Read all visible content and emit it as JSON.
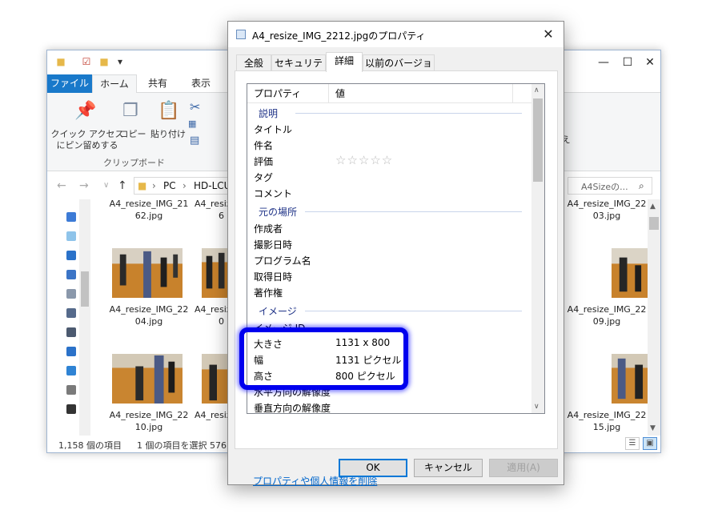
{
  "explorer": {
    "ribbon_tabs": [
      "ファイル",
      "ホーム",
      "共有",
      "表示"
    ],
    "ribbon": {
      "pin_label_line1": "クイック アクセス",
      "pin_label_line2": "にピン留めする",
      "copy_label": "コピー",
      "paste_label": "貼り付け",
      "group_label": "クリップボード",
      "cut_right_label": "え"
    },
    "address": {
      "segment1": "PC",
      "segment2": "HD-LCU",
      "search_placeholder": "A4Sizeの..."
    },
    "files": [
      {
        "line1": "A4_resize_IMG_21",
        "line2": "62.jpg"
      },
      {
        "line1": "A4_resize_IMG_22",
        "line2": "04.jpg"
      },
      {
        "line1": "A4_resize_IMG_22",
        "line2": "10.jpg"
      },
      {
        "line1": "A4_resiz",
        "line2": "6"
      },
      {
        "line1": "A4_resiz",
        "line2": "0"
      },
      {
        "line1": "A4_resiz",
        "line2": ""
      },
      {
        "line1": "A4_resize_IMG_22",
        "line2": "03.jpg"
      },
      {
        "line1": "A4_resize_IMG_22",
        "line2": "09.jpg"
      },
      {
        "line1": "A4_resize_IMG_22",
        "line2": "15.jpg"
      }
    ],
    "status": {
      "count": "1,158 個の項目",
      "selected": "1 個の項目を選択  576"
    }
  },
  "dialog": {
    "title": "A4_resize_IMG_2212.jpgのプロパティ",
    "tabs": [
      "全般",
      "セキュリティ",
      "詳細",
      "以前のバージョン"
    ],
    "active_tab": "詳細",
    "list": {
      "col_property": "プロパティ",
      "col_value": "値",
      "groups": {
        "description": "説明",
        "origin": "元の場所",
        "image": "イメージ"
      },
      "description_rows": [
        {
          "prop": "タイトル",
          "val": ""
        },
        {
          "prop": "件名",
          "val": ""
        },
        {
          "prop": "評価",
          "val": ""
        },
        {
          "prop": "タグ",
          "val": ""
        },
        {
          "prop": "コメント",
          "val": ""
        }
      ],
      "rating_stars": "☆☆☆☆☆",
      "rating_value": 0,
      "origin_rows": [
        {
          "prop": "作成者",
          "val": ""
        },
        {
          "prop": "撮影日時",
          "val": ""
        },
        {
          "prop": "プログラム名",
          "val": ""
        },
        {
          "prop": "取得日時",
          "val": ""
        },
        {
          "prop": "著作権",
          "val": ""
        }
      ],
      "image_rows": [
        {
          "prop": "イメージ ID",
          "val": ""
        },
        {
          "prop": "大きさ",
          "val": "1131 x 800"
        },
        {
          "prop": "幅",
          "val": "1131 ピクセル"
        },
        {
          "prop": "高さ",
          "val": "800 ピクセル"
        },
        {
          "prop": "水平方向の解像度",
          "val": ""
        },
        {
          "prop": "垂直方向の解像度",
          "val": ""
        }
      ]
    },
    "remove_link": "プロパティや個人情報を削除",
    "buttons": {
      "ok": "OK",
      "cancel": "キャンセル",
      "apply": "適用(A)"
    },
    "highlight_color": "#0000ee"
  }
}
